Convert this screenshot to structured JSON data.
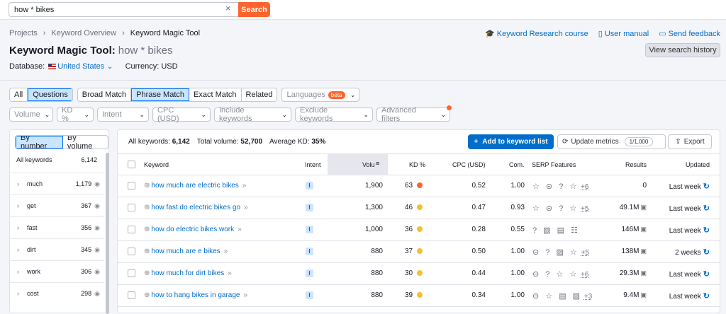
{
  "search": {
    "value": "how * bikes",
    "clear_icon": "×",
    "button": "Search"
  },
  "breadcrumb": [
    "Projects",
    "Keyword Overview",
    "Keyword Magic Tool"
  ],
  "title": {
    "prefix": "Keyword Magic Tool:",
    "query": "how * bikes"
  },
  "database": {
    "label": "Database:",
    "country": "United States",
    "currency": "Currency: USD"
  },
  "top_links": {
    "research_course": "Keyword Research course",
    "manual": "User manual",
    "feedback": "Send feedback"
  },
  "view_history": "View search history",
  "match_tabs": {
    "all": "All",
    "questions": "Questions",
    "broad": "Broad Match",
    "phrase": "Phrase Match",
    "exact": "Exact Match",
    "related": "Related"
  },
  "languages": {
    "label": "Languages",
    "badge": "beta"
  },
  "filters": {
    "volume": "Volume",
    "kd": "KD %",
    "intent": "Intent",
    "cpc": "CPC (USD)",
    "include": "Include keywords",
    "exclude": "Exclude keywords",
    "advanced": "Advanced filters"
  },
  "side": {
    "by_number": "By number",
    "by_volume": "By volume",
    "all_label": "All keywords",
    "all_count": "6,142",
    "groups": [
      {
        "word": "much",
        "count": "1,179"
      },
      {
        "word": "get",
        "count": "367"
      },
      {
        "word": "fast",
        "count": "356"
      },
      {
        "word": "dirt",
        "count": "345"
      },
      {
        "word": "work",
        "count": "306"
      },
      {
        "word": "cost",
        "count": "298"
      }
    ]
  },
  "summary": {
    "all_label": "All keywords:",
    "all": "6,142",
    "vol_label": "Total volume:",
    "vol": "52,700",
    "kd_label": "Average KD:",
    "kd": "35%"
  },
  "actions": {
    "add": "Add to keyword list",
    "update": "Update metrics",
    "update_count": "1/1,000",
    "export": "Export"
  },
  "columns": {
    "keyword": "Keyword",
    "intent": "Intent",
    "volume": "Volu",
    "kd": "KD %",
    "cpc": "CPC (USD)",
    "com": "Com.",
    "serp": "SERP Features",
    "results": "Results",
    "updated": "Updated"
  },
  "colors": {
    "orange": "#ff642d",
    "blue": "#006dca",
    "kd_red": "#ff642d",
    "kd_yellow": "#f6c02d"
  },
  "rows": [
    {
      "keyword": "how much are electric bikes",
      "intent": "I",
      "volume": "1,900",
      "kd": "63",
      "kd_color": "#ff642d",
      "cpc": "0.52",
      "com": "1.00",
      "serp": "☆ ⊝ ? ☆",
      "more": "+6",
      "results": "0",
      "updated": "Last week"
    },
    {
      "keyword": "how fast do electric bikes go",
      "intent": "I",
      "volume": "1,300",
      "kd": "46",
      "kd_color": "#f6c02d",
      "cpc": "0.47",
      "com": "0.93",
      "serp": "☆ ⊝ ? ☆",
      "more": "+5",
      "results": "49.1M",
      "updated": "Last week"
    },
    {
      "keyword": "how do electric bikes work",
      "intent": "I",
      "volume": "1,000",
      "kd": "36",
      "kd_color": "#f6c02d",
      "cpc": "0.28",
      "com": "0.55",
      "serp": "? ▨ ▤ ☷",
      "more": "",
      "results": "146M",
      "updated": "Last week"
    },
    {
      "keyword": "how much are e bikes",
      "intent": "I",
      "volume": "880",
      "kd": "37",
      "kd_color": "#f6c02d",
      "cpc": "0.50",
      "com": "1.00",
      "serp": "⊝ ? ▨ ☆",
      "more": "+5",
      "results": "138M",
      "updated": "2 weeks"
    },
    {
      "keyword": "how much for dirt bikes",
      "intent": "I",
      "volume": "880",
      "kd": "30",
      "kd_color": "#f6c02d",
      "cpc": "0.44",
      "com": "1.00",
      "serp": "⊝ ? ☆ ☆",
      "more": "+6",
      "results": "29.3M",
      "updated": "Last week"
    },
    {
      "keyword": "how to hang bikes in garage",
      "intent": "I",
      "volume": "880",
      "kd": "39",
      "kd_color": "#f6c02d",
      "cpc": "0.34",
      "com": "1.00",
      "serp": "⊝ ☆ ▤ ▨",
      "more": "+3",
      "results": "9.4M",
      "updated": "Last week"
    }
  ]
}
